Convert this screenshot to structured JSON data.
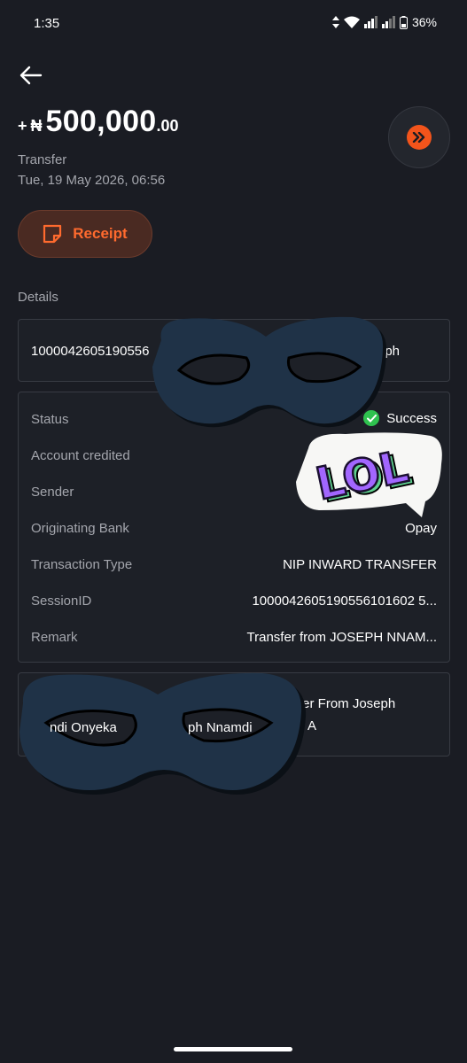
{
  "status_bar": {
    "time": "1:35",
    "battery": "36%"
  },
  "amount": {
    "sign": "+",
    "currency": "₦",
    "main": "500,000",
    "decimals": ".00"
  },
  "transaction": {
    "type": "Transfer",
    "date": "Tue, 19 May 2026, 06:56"
  },
  "receipt_label": "Receipt",
  "details_label": "Details",
  "card1": {
    "left": "1000042605190556",
    "right": "ph"
  },
  "rows": [
    {
      "label": "Status",
      "value": "Success"
    },
    {
      "label": "Account credited",
      "value": ""
    },
    {
      "label": "Sender",
      "value": ""
    },
    {
      "label": "Originating Bank",
      "value": "Opay"
    },
    {
      "label": "Transaction Type",
      "value": "NIP INWARD TRANSFER"
    },
    {
      "label": "SessionID",
      "value": "1000042605190556101602 5..."
    },
    {
      "label": "Remark",
      "value": "Transfer from JOSEPH NNAM..."
    }
  ],
  "card3": {
    "line1": "fer From Joseph",
    "frag1": "ndi Onyeka",
    "frag2": "ph Nnamdi",
    "frag3": "A"
  },
  "sticker_text": "LOL",
  "colors": {
    "accent": "#f2541b",
    "success": "#2fc24f",
    "mask": "#1f3247"
  }
}
